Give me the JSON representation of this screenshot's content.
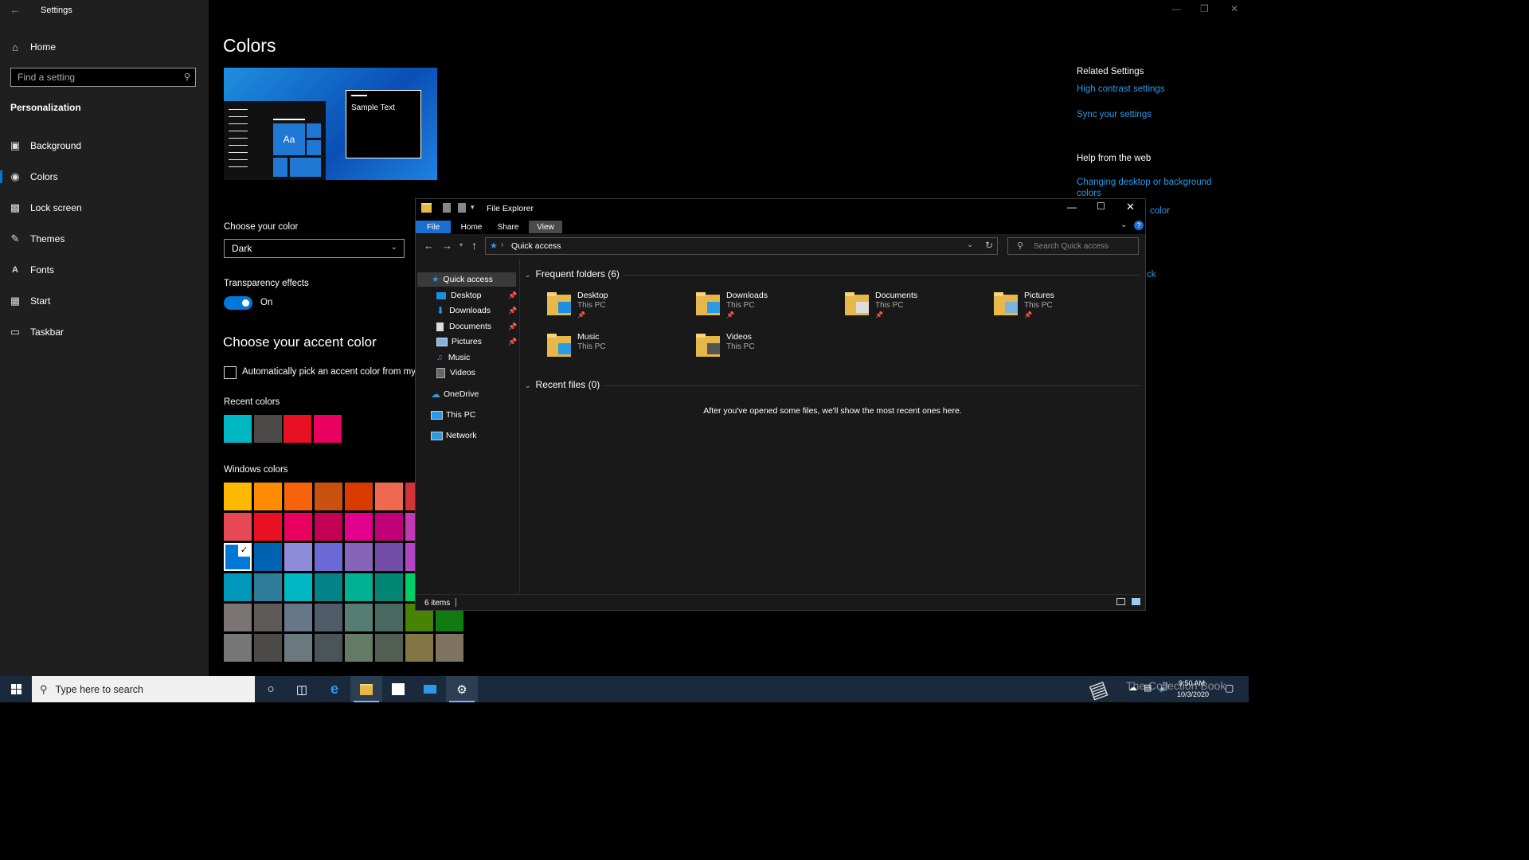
{
  "settings": {
    "window_title": "Settings",
    "home": "Home",
    "search_placeholder": "Find a setting",
    "section": "Personalization",
    "nav": [
      {
        "label": "Background",
        "icon": "image-icon"
      },
      {
        "label": "Colors",
        "icon": "palette-icon"
      },
      {
        "label": "Lock screen",
        "icon": "lock-screen-icon"
      },
      {
        "label": "Themes",
        "icon": "brush-icon"
      },
      {
        "label": "Fonts",
        "icon": "font-icon"
      },
      {
        "label": "Start",
        "icon": "start-icon"
      },
      {
        "label": "Taskbar",
        "icon": "taskbar-icon"
      }
    ],
    "active_nav": "Colors"
  },
  "colors_page": {
    "title": "Colors",
    "preview_sample_text": "Sample Text",
    "preview_tile_label": "Aa",
    "choose_color_label": "Choose your color",
    "choose_color_value": "Dark",
    "transparency_label": "Transparency effects",
    "transparency_state": "On",
    "accent_heading": "Choose your accent color",
    "auto_pick_label": "Automatically pick an accent color from my",
    "recent_colors_label": "Recent colors",
    "recent_colors": [
      "#00b7c3",
      "#4c4a48",
      "#e81123",
      "#ea005e"
    ],
    "windows_colors_label": "Windows colors",
    "windows_colors": [
      [
        "#ffb900",
        "#ff8c00",
        "#f7630c",
        "#ca5010",
        "#da3b01",
        "#ef6950",
        "#d13438"
      ],
      [
        "#e74856",
        "#e81123",
        "#ea005e",
        "#c30052",
        "#e3008c",
        "#bf0077",
        "#c239b3"
      ],
      [
        "#0078d7",
        "#0063b1",
        "#8e8cd8",
        "#6b69d6",
        "#8764b8",
        "#744da9",
        "#b146c2"
      ],
      [
        "#0099bc",
        "#2d7d9a",
        "#00b7c3",
        "#038387",
        "#00b294",
        "#018574",
        "#00cc6a"
      ],
      [
        "#7a7574",
        "#5d5a58",
        "#68768a",
        "#515c6b",
        "#567c73",
        "#486860",
        "#498205",
        "#107c10"
      ],
      [
        "#767676",
        "#4c4a48",
        "#69797e",
        "#4a5459",
        "#647c64",
        "#525e54",
        "#847545",
        "#7e735f"
      ]
    ],
    "selected_color": "#0078d7",
    "accent": "#0078d7"
  },
  "related": {
    "heading": "Related Settings",
    "links": [
      "High contrast settings",
      "Sync your settings"
    ],
    "web_heading": "Help from the web",
    "web_links": [
      "Changing desktop or background colors",
      "color",
      "ck"
    ]
  },
  "explorer": {
    "title": "File Explorer",
    "tabs": [
      "File",
      "Home",
      "Share",
      "View"
    ],
    "address": "Quick access",
    "search_placeholder": "Search Quick access",
    "tree": [
      {
        "label": "Quick access",
        "icon": "star-icon",
        "pinned": false
      },
      {
        "label": "Desktop",
        "icon": "desktop-folder-icon",
        "pinned": true
      },
      {
        "label": "Downloads",
        "icon": "downloads-icon",
        "pinned": true
      },
      {
        "label": "Documents",
        "icon": "documents-icon",
        "pinned": true
      },
      {
        "label": "Pictures",
        "icon": "pictures-icon",
        "pinned": true
      },
      {
        "label": "Music",
        "icon": "music-icon",
        "pinned": false
      },
      {
        "label": "Videos",
        "icon": "videos-icon",
        "pinned": false
      },
      {
        "label": "OneDrive",
        "icon": "onedrive-icon",
        "pinned": false
      },
      {
        "label": "This PC",
        "icon": "this-pc-icon",
        "pinned": false
      },
      {
        "label": "Network",
        "icon": "network-icon",
        "pinned": false
      }
    ],
    "frequent_heading": "Frequent folders (6)",
    "folders": [
      {
        "name": "Desktop",
        "location": "This PC",
        "pinned": true
      },
      {
        "name": "Downloads",
        "location": "This PC",
        "pinned": true
      },
      {
        "name": "Documents",
        "location": "This PC",
        "pinned": true
      },
      {
        "name": "Pictures",
        "location": "This PC",
        "pinned": true
      },
      {
        "name": "Music",
        "location": "This PC",
        "pinned": false
      },
      {
        "name": "Videos",
        "location": "This PC",
        "pinned": false
      }
    ],
    "recent_heading": "Recent files (0)",
    "recent_empty": "After you've opened some files, we'll show the most recent ones here.",
    "status": "6 items"
  },
  "taskbar": {
    "search_placeholder": "Type here to search",
    "time": "9:50 AM",
    "date": "10/3/2020",
    "watermark": "The Collection Book"
  }
}
